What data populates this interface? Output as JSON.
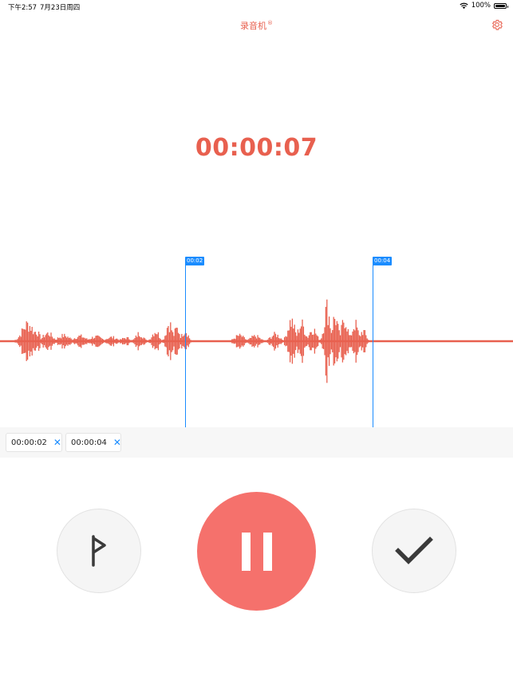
{
  "status": {
    "time": "下午2:57",
    "date": "7月23日周四",
    "battery": "100%"
  },
  "header": {
    "title": "录音机",
    "title_mark": "®"
  },
  "timer": "00:00:07",
  "markers": [
    {
      "tag": "00:02"
    },
    {
      "tag": "00:04"
    }
  ],
  "mark_chips": [
    {
      "label": "00:00:02"
    },
    {
      "label": "00:00:04"
    }
  ],
  "colors": {
    "accent": "#e8604f",
    "marker": "#1a8cff",
    "pause_button": "#f5716c"
  }
}
